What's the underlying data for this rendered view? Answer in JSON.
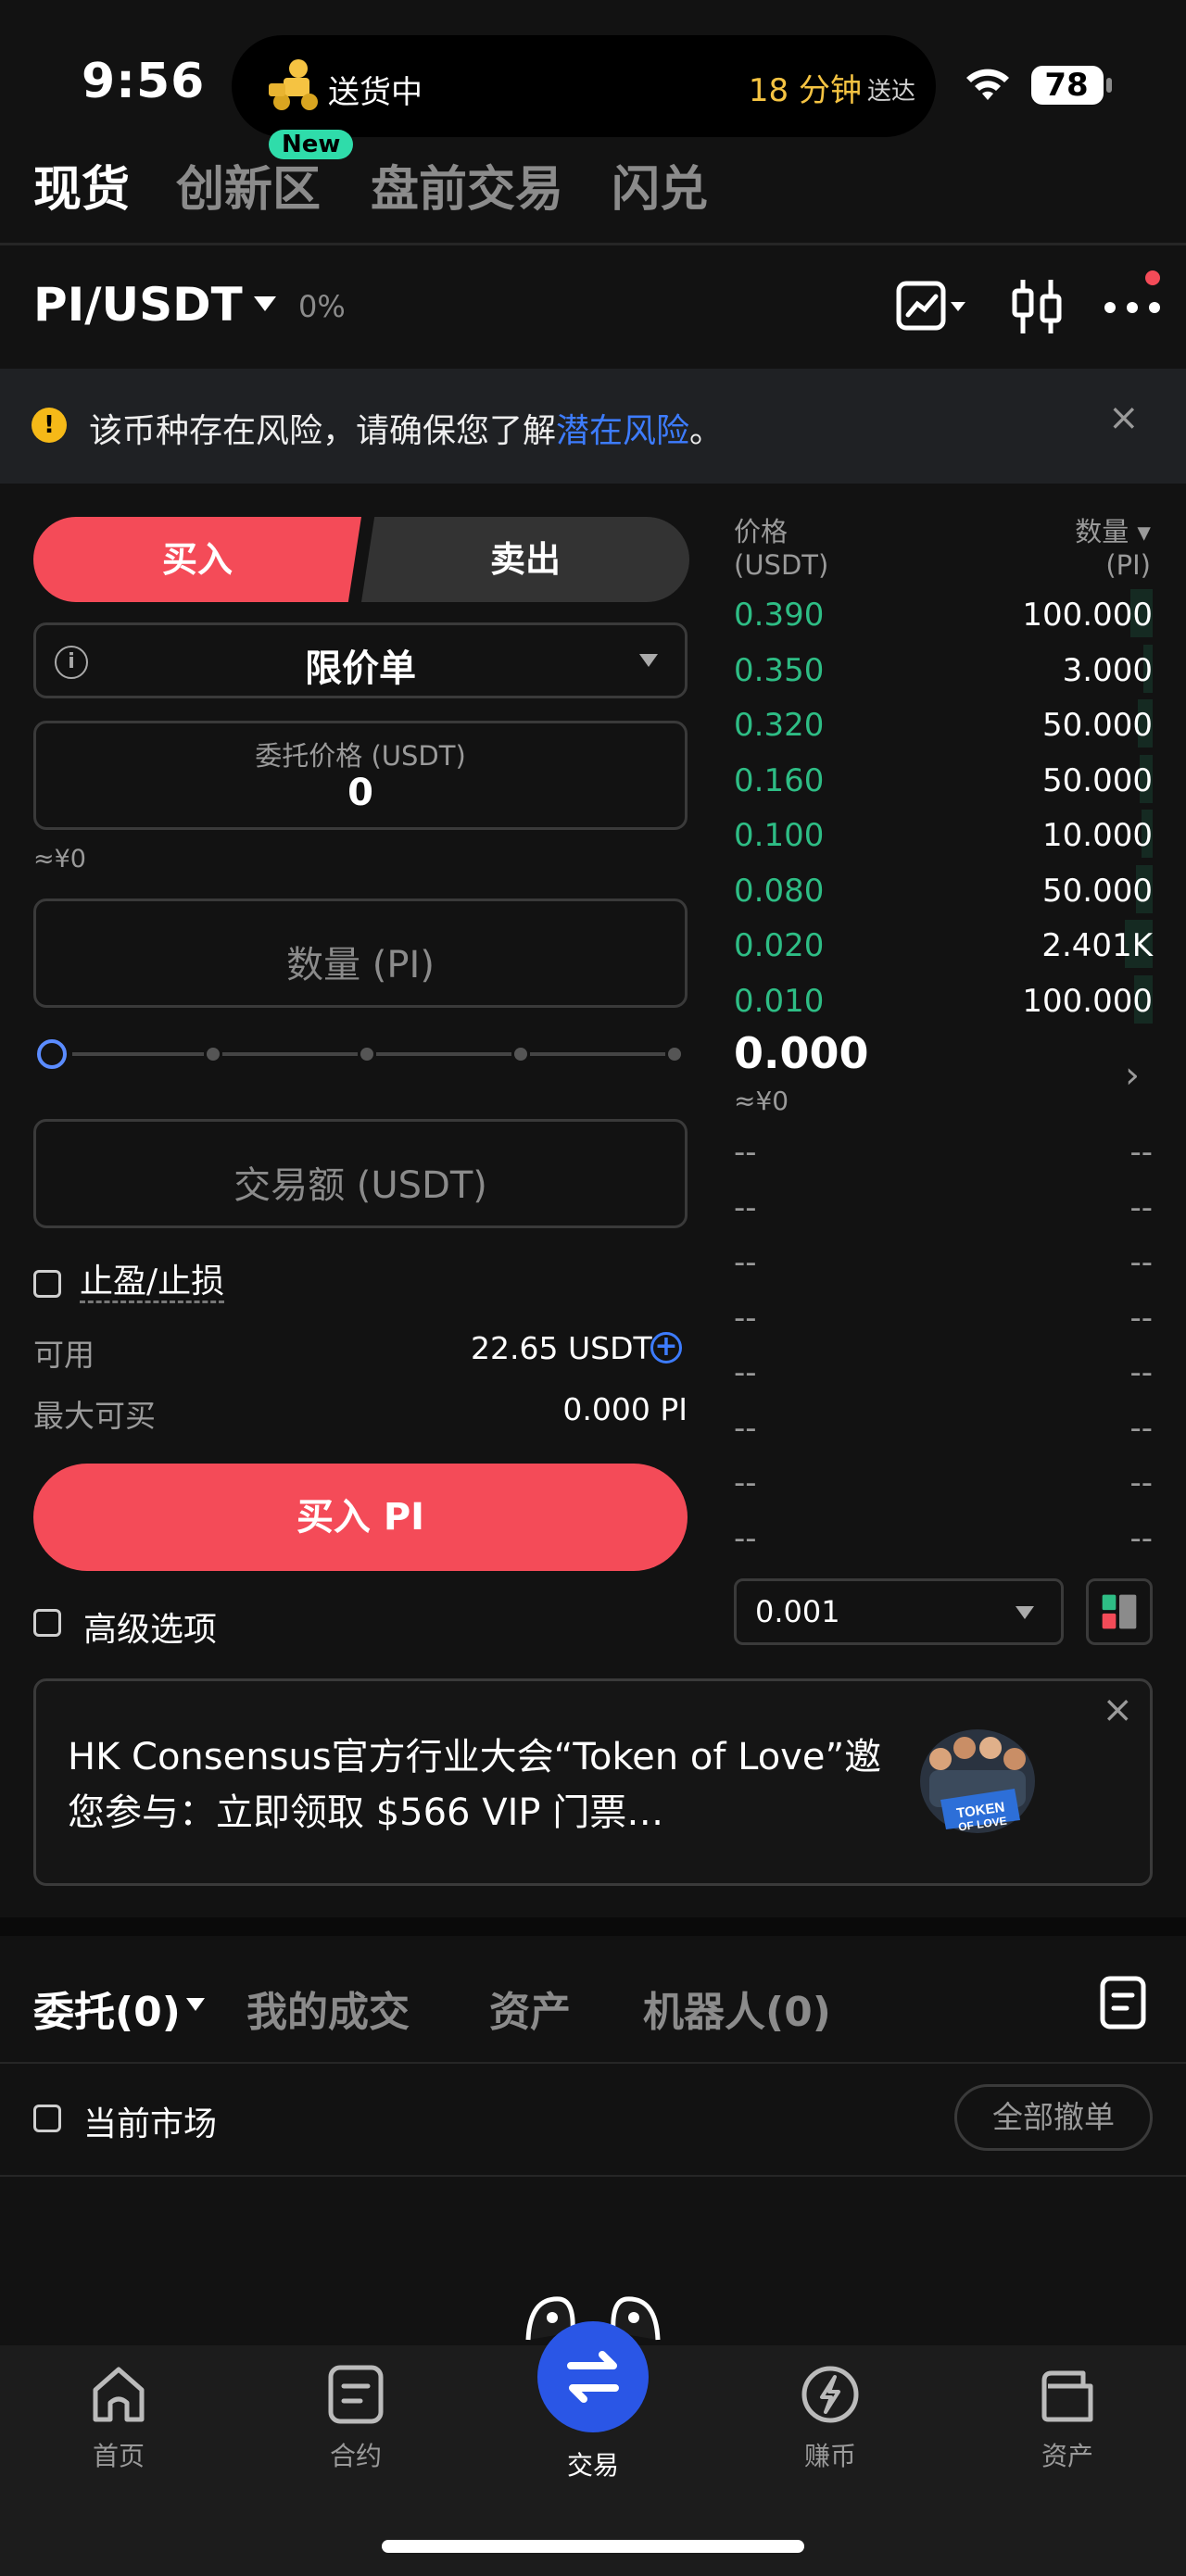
{
  "status": {
    "time": "9:56",
    "live_activity_left": "送货中",
    "live_activity_right_big": "18 分钟",
    "live_activity_right_small": "送达",
    "battery": "78"
  },
  "top_tabs": [
    {
      "label": "现货",
      "active": true
    },
    {
      "label": "创新区",
      "badge": "New"
    },
    {
      "label": "盘前交易"
    },
    {
      "label": "闪兑"
    }
  ],
  "pair": {
    "name": "PI/USDT",
    "change": "0%"
  },
  "risk": {
    "text": "该币种存在风险，请确保您了解",
    "link": "潜在风险",
    "end": "。",
    "close": "×"
  },
  "form": {
    "buy_label": "买入",
    "sell_label": "卖出",
    "order_type": "限价单",
    "price_label": "委托价格 (USDT)",
    "price_value": "0",
    "price_approx": "≈¥0",
    "qty_placeholder": "数量 (PI)",
    "amount_placeholder": "交易额 (USDT)",
    "tpsl_label": "止盈/止损",
    "available_label": "可用",
    "available_value": "22.65 USDT",
    "maxbuy_label": "最大可买",
    "maxbuy_value": "0.000 PI",
    "buy_button": "买入 PI",
    "advanced_label": "高级选项",
    "slider_value_pct": 0
  },
  "orderbook": {
    "price_header": "价格",
    "price_unit": "(USDT)",
    "qty_header": "数量 ▾",
    "qty_unit": "(PI)",
    "asks": [
      {
        "price": "0.390",
        "qty": "100.000"
      },
      {
        "price": "0.350",
        "qty": "3.000"
      },
      {
        "price": "0.320",
        "qty": "50.000"
      },
      {
        "price": "0.160",
        "qty": "50.000"
      },
      {
        "price": "0.100",
        "qty": "10.000"
      },
      {
        "price": "0.080",
        "qty": "50.000"
      },
      {
        "price": "0.020",
        "qty": "2.401K"
      },
      {
        "price": "0.010",
        "qty": "100.000"
      }
    ],
    "last_price": "0.000",
    "last_approx": "≈¥0",
    "bids": [
      {
        "price": "--",
        "qty": "--"
      },
      {
        "price": "--",
        "qty": "--"
      },
      {
        "price": "--",
        "qty": "--"
      },
      {
        "price": "--",
        "qty": "--"
      },
      {
        "price": "--",
        "qty": "--"
      },
      {
        "price": "--",
        "qty": "--"
      },
      {
        "price": "--",
        "qty": "--"
      },
      {
        "price": "--",
        "qty": "--"
      }
    ],
    "precision": "0.001"
  },
  "promo": {
    "text": "HK Consensus官方行业大会“Token of Love”邀您参与：立即领取 $566 VIP 门票…",
    "image_text": "TOKEN OF LOVE",
    "close": "×"
  },
  "orders": {
    "tab_active": "委托(0)",
    "tabs": [
      "我的成交",
      "资产",
      "机器人(0)"
    ],
    "current_market_label": "当前市场",
    "cancel_all": "全部撤单"
  },
  "nav": [
    {
      "label": "首页",
      "icon": "home-icon"
    },
    {
      "label": "合约",
      "icon": "futures-icon"
    },
    {
      "label": "交易",
      "icon": "trade-swap-icon",
      "active": true
    },
    {
      "label": "赚币",
      "icon": "earn-icon"
    },
    {
      "label": "资产",
      "icon": "wallet-icon"
    }
  ],
  "colors": {
    "buy": "#f44b58",
    "ask_green": "#2ebd85",
    "link_blue": "#3d7cff",
    "nav_active": "#2a56e6"
  }
}
